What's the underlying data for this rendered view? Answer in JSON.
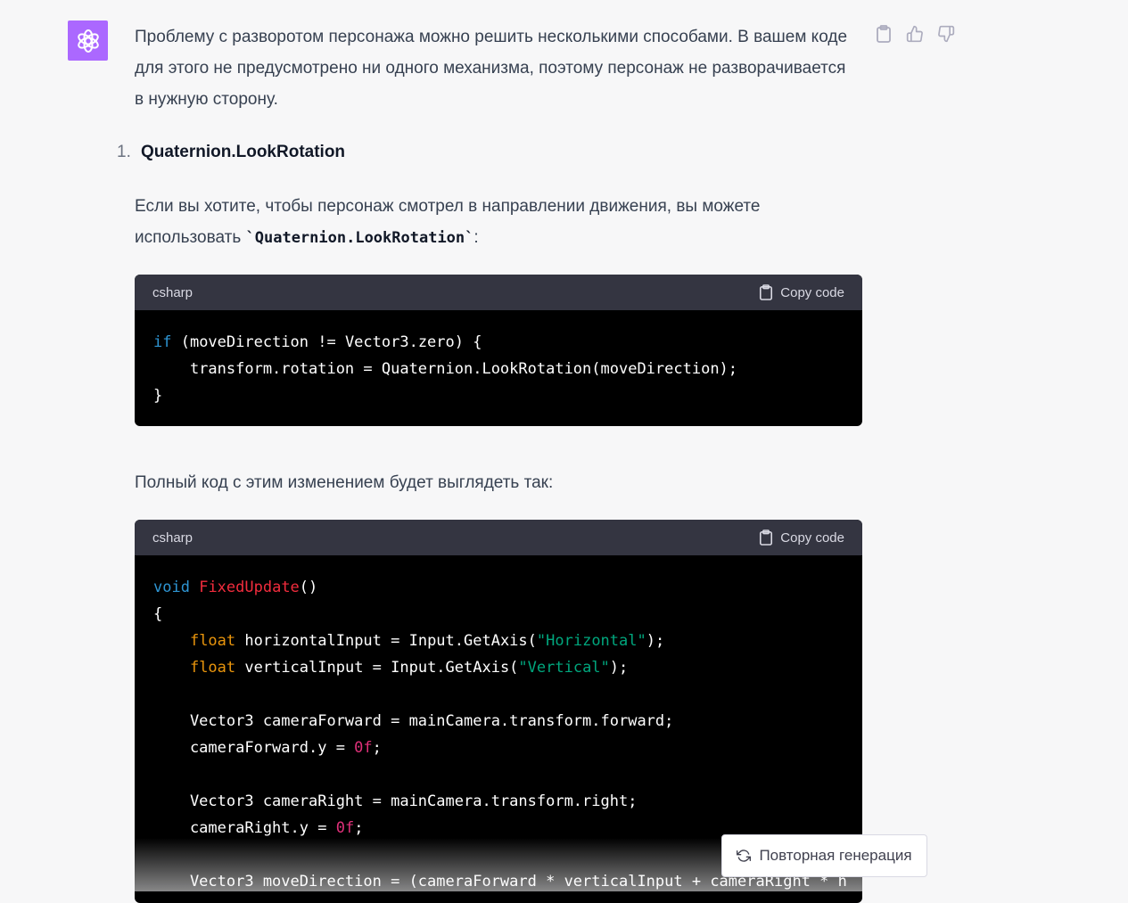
{
  "message": {
    "intro": "Проблему с разворотом персонажа можно решить несколькими способами. В вашем коде для этого не предусмотрено ни одного механизма, поэтому персонаж не разворачивается в нужную сторону.",
    "list_number": "1.",
    "list_heading": "Quaternion.LookRotation",
    "paragraph2_before": "Если вы хотите, чтобы персонаж смотрел в направлении движения, вы можете использовать ",
    "paragraph2_code": "`Quaternion.LookRotation`",
    "paragraph2_after": ":",
    "paragraph3": "Полный код с этим изменением будет выглядеть так:"
  },
  "code_blocks": [
    {
      "language": "csharp",
      "copy_label": "Copy code",
      "lines": [
        "if (moveDirection != Vector3.zero) {",
        "    transform.rotation = Quaternion.LookRotation(moveDirection);",
        "}"
      ]
    },
    {
      "language": "csharp",
      "copy_label": "Copy code",
      "lines": [
        "void FixedUpdate()",
        "{",
        "    float horizontalInput = Input.GetAxis(\"Horizontal\");",
        "    float verticalInput = Input.GetAxis(\"Vertical\");",
        "",
        "    Vector3 cameraForward = mainCamera.transform.forward;",
        "    cameraForward.y = 0f;",
        "",
        "    Vector3 cameraRight = mainCamera.transform.right;",
        "    cameraRight.y = 0f;",
        "",
        "    Vector3 moveDirection = (cameraForward * verticalInput + cameraRight * h"
      ]
    }
  ],
  "regenerate_label": "Повторная генерация",
  "icons": {
    "avatar": "openai-logo-icon",
    "copy_message": "clipboard-icon",
    "like": "thumbs-up-icon",
    "dislike": "thumbs-down-icon",
    "regenerate": "refresh-icon"
  },
  "colors": {
    "avatar_bg": "#ab68ff",
    "keyword": "#2e95d3",
    "type_keyword": "#e9950c",
    "function": "#f22c3d",
    "string": "#00a67d",
    "number": "#df3079"
  }
}
